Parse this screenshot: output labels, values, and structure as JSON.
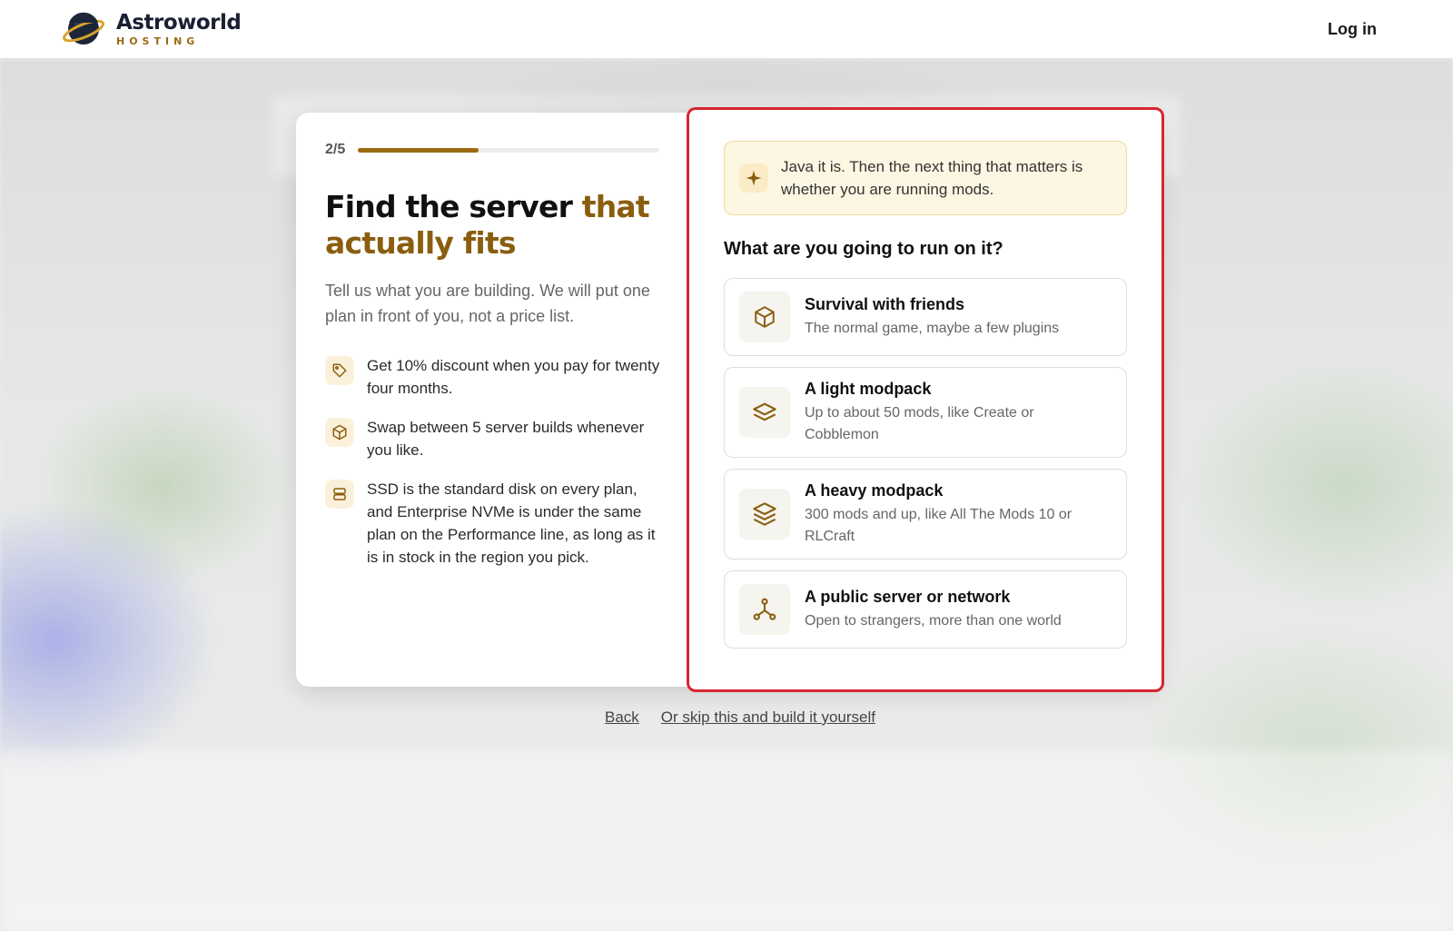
{
  "header": {
    "brand_name": "Astroworld",
    "brand_sub": "HOSTING",
    "login_label": "Log in"
  },
  "progress": {
    "step_label": "2/5",
    "fraction": 0.4
  },
  "left": {
    "headline_main": "Find the server ",
    "headline_accent": "that actually fits",
    "lead": "Tell us what you are building. We will put one plan in front of you, not a price list.",
    "features": [
      {
        "icon": "tag-icon",
        "text": "Get 10% discount when you pay for twenty four months."
      },
      {
        "icon": "cube-icon",
        "text": "Swap between 5 server builds whenever you like."
      },
      {
        "icon": "server-icon",
        "text": "SSD is the standard disk on every plan, and Enterprise NVMe is under the same plan on the Performance line, as long as it is in stock in the region you pick."
      }
    ]
  },
  "right": {
    "hint": "Java it is. Then the next thing that matters is whether you are running mods.",
    "question": "What are you going to run on it?",
    "options": [
      {
        "icon": "cube-icon",
        "title": "Survival with friends",
        "desc": "The normal game, maybe a few plugins"
      },
      {
        "icon": "layers-icon",
        "title": "A light modpack",
        "desc": "Up to about 50 mods, like Create or Cobblemon"
      },
      {
        "icon": "layers-stack-icon",
        "title": "A heavy modpack",
        "desc": "300 mods and up, like All The Mods 10 or RLCraft"
      },
      {
        "icon": "network-icon",
        "title": "A public server or network",
        "desc": "Open to strangers, more than one world"
      }
    ]
  },
  "footer": {
    "back_label": "Back",
    "skip_label": "Or skip this and build it yourself"
  },
  "colors": {
    "accent": "#8a5e0f",
    "highlight_border": "#d9252f"
  }
}
